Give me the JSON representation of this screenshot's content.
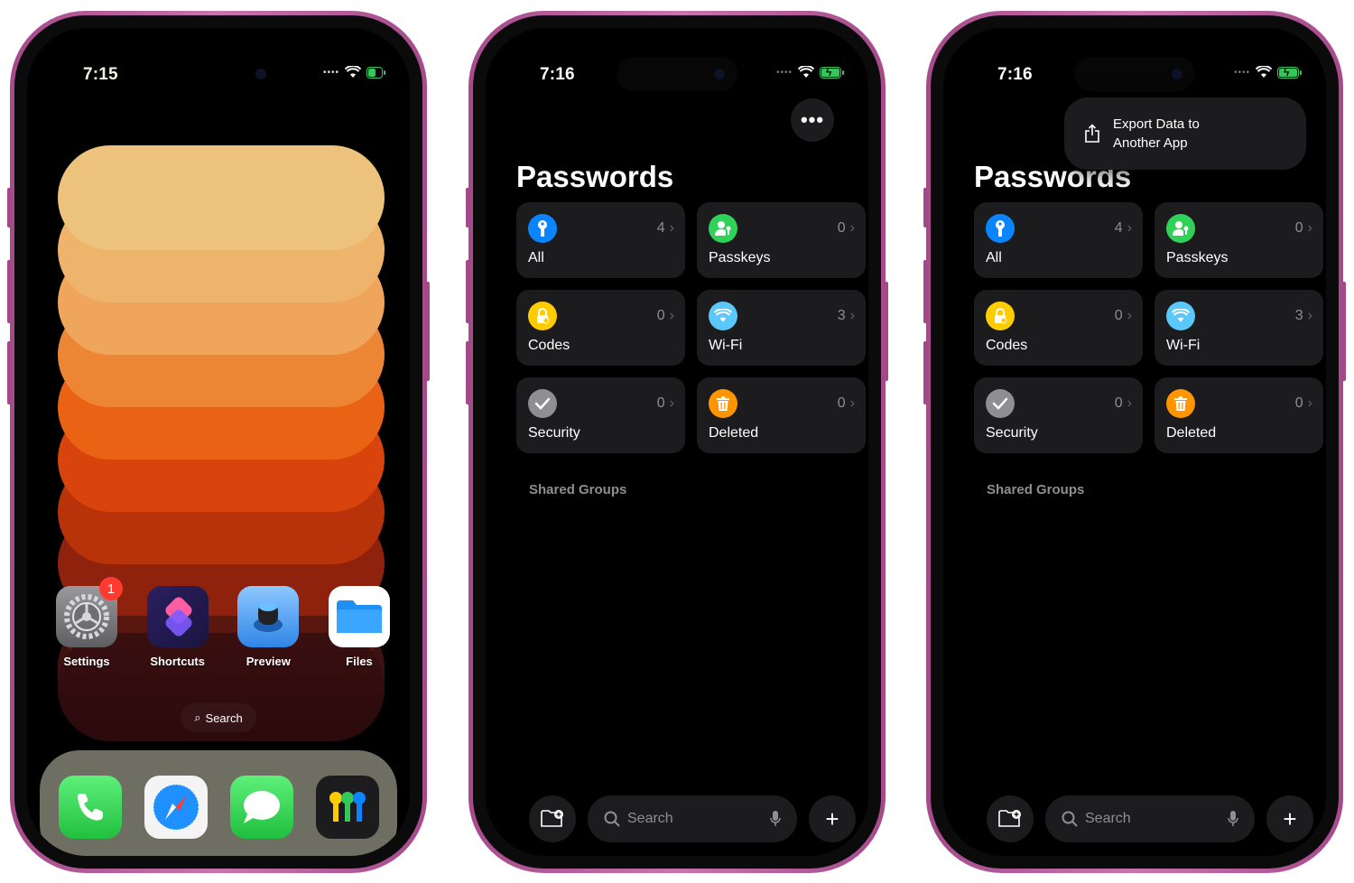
{
  "home": {
    "time": "7:15",
    "apps": [
      {
        "label": "Settings",
        "badge": "1"
      },
      {
        "label": "Shortcuts"
      },
      {
        "label": "Preview"
      },
      {
        "label": "Files"
      }
    ],
    "search_label": "Search",
    "dock": [
      "phone-icon",
      "safari-icon",
      "messages-icon",
      "passwords-icon"
    ]
  },
  "screen2": {
    "time": "7:16",
    "title": "Passwords",
    "tiles": [
      {
        "label": "All",
        "count": "4",
        "color": "#0a84ff",
        "icon": "key-icon"
      },
      {
        "label": "Passkeys",
        "count": "0",
        "color": "#30d158",
        "icon": "passkey-icon"
      },
      {
        "label": "Codes",
        "count": "0",
        "color": "#ffcc00",
        "icon": "lock-icon"
      },
      {
        "label": "Wi-Fi",
        "count": "3",
        "color": "#5ac8fa",
        "icon": "wifi-icon"
      },
      {
        "label": "Security",
        "count": "0",
        "color": "#8e8e93",
        "icon": "checkmark-icon"
      },
      {
        "label": "Deleted",
        "count": "0",
        "color": "#ff9500",
        "icon": "trash-icon"
      }
    ],
    "section": "Shared Groups",
    "search_placeholder": "Search"
  },
  "screen3": {
    "time": "7:16",
    "title": "Passwords",
    "menu_item_line1": "Export Data to",
    "menu_item_line2": "Another App",
    "tiles": [
      {
        "label": "All",
        "count": "4"
      },
      {
        "label": "Passkeys",
        "count": "0"
      },
      {
        "label": "Codes",
        "count": "0"
      },
      {
        "label": "Wi-Fi",
        "count": "3"
      },
      {
        "label": "Security",
        "count": "0"
      },
      {
        "label": "Deleted",
        "count": "0"
      }
    ],
    "section": "Shared Groups",
    "search_placeholder": "Search"
  },
  "chevron": "›"
}
